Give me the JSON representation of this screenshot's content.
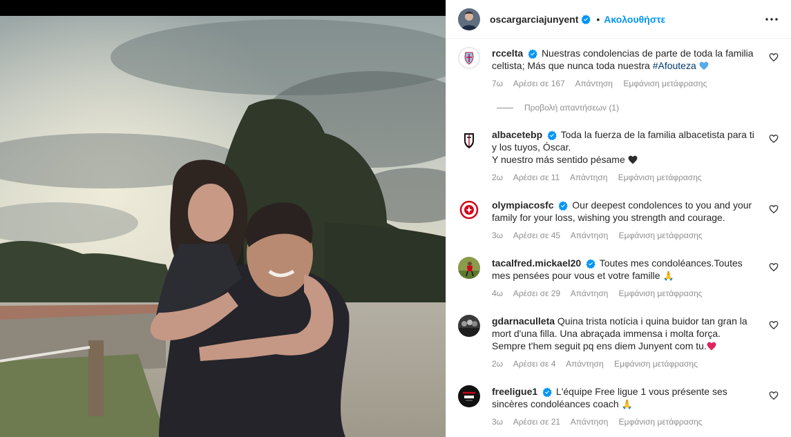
{
  "post": {
    "author": "oscargarciajunyent",
    "follow_label": "Ακολουθήστε",
    "dot": "•"
  },
  "comments": [
    {
      "username": "rccelta",
      "text": "Nuestras condolencias de parte de toda la familia celtista; Más que nunca toda nuestra ",
      "hashtag": "#Afouteza",
      "emoji": "blue-heart",
      "time": "7ω",
      "likes": "Αρέσει σε 167",
      "reply": "Απάντηση",
      "translate": "Εμφάνιση μετάφρασης",
      "view_replies": "Προβολή απαντήσεων (1)"
    },
    {
      "username": "albacetebp",
      "text": "Toda la fuerza de la familia albacetista para ti y los tuyos, Óscar.",
      "text2": "Y nuestro más sentido pésame",
      "emoji": "black-heart",
      "time": "2ω",
      "likes": "Αρέσει σε 11",
      "reply": "Απάντηση",
      "translate": "Εμφάνιση μετάφρασης"
    },
    {
      "username": "olympiacosfc",
      "text": "Our deepest condolences to you and your family for your loss, wishing you strength and courage.",
      "time": "3ω",
      "likes": "Αρέσει σε 45",
      "reply": "Απάντηση",
      "translate": "Εμφάνιση μετάφρασης"
    },
    {
      "username": "tacalfred.mickael20",
      "text": "Toutes mes condoléances.Toutes mes pensées pour vous et votre famille ",
      "emoji": "praying-hands",
      "time": "4ω",
      "likes": "Αρέσει σε 29",
      "reply": "Απάντηση",
      "translate": "Εμφάνιση μετάφρασης"
    },
    {
      "username": "gdarnaculleta",
      "text": "Quina trista notícia i quina buidor tan gran la mort d'una filla. Una abraçada immensa i molta força. Sempre t'hem seguit pq ens diem Junyent com tu.",
      "emoji": "red-heart",
      "time": "2ω",
      "likes": "Αρέσει σε 4",
      "reply": "Απάντηση",
      "translate": "Εμφάνιση μετάφρασης"
    },
    {
      "username": "freeligue1",
      "text": "L'équipe Free ligue 1 vous présente ses sincères condoléances coach ",
      "emoji": "praying-hands",
      "time": "3ω",
      "likes": "Αρέσει σε 21",
      "reply": "Απάντηση",
      "translate": "Εμφάνιση μετάφρασης"
    }
  ],
  "colors": {
    "accent": "#0095f6",
    "verified": "#0095f6",
    "muted": "#8e8e8e",
    "text": "#262626",
    "hashtag": "#00376b"
  },
  "icons": [
    "verified-badge-icon",
    "more-options-icon",
    "heart-outline-icon",
    "blue-heart-emoji",
    "black-heart-emoji",
    "red-heart-emoji",
    "praying-hands-emoji"
  ]
}
